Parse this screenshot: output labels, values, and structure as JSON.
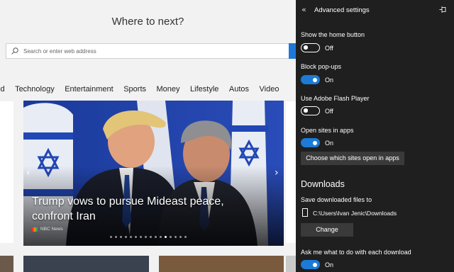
{
  "newtab": {
    "title": "Where to next?",
    "search_placeholder": "Search or enter web address",
    "categories": [
      "ld",
      "Technology",
      "Entertainment",
      "Sports",
      "Money",
      "Lifestyle",
      "Autos",
      "Video"
    ],
    "hero": {
      "headline": "Trump vows to pursue Mideast peace, confront Iran",
      "source": "NBC News",
      "slide_count": 16,
      "active_slide": 11
    }
  },
  "settings": {
    "title": "Advanced settings",
    "back_icon": "back-arrow-icon",
    "pin_icon": "pin-icon",
    "home_button": {
      "label": "Show the home button",
      "state": "Off",
      "on": false
    },
    "popups": {
      "label": "Block pop-ups",
      "state": "On",
      "on": true
    },
    "flash": {
      "label": "Use Adobe Flash Player",
      "state": "Off",
      "on": false
    },
    "apps": {
      "label": "Open sites in apps",
      "state": "On",
      "on": true,
      "button": "Choose which sites open in apps"
    },
    "downloads": {
      "heading": "Downloads",
      "save_label": "Save downloaded files to",
      "path": "C:\\Users\\Ivan Jenic\\Downloads",
      "change_button": "Change",
      "ask": {
        "label": "Ask me what to do with each download",
        "state": "On",
        "on": true
      }
    }
  },
  "colors": {
    "accent": "#1c7bd6",
    "pane_bg": "#1f1f1f",
    "page_bg": "#f2f2f2"
  }
}
